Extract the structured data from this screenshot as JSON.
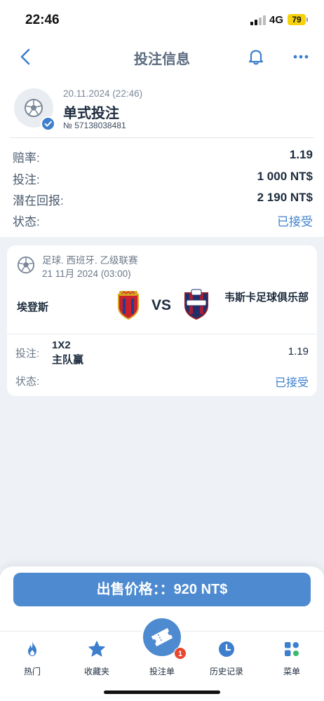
{
  "status_bar": {
    "time": "22:46",
    "network": "4G",
    "battery": "79"
  },
  "nav": {
    "title": "投注信息",
    "back_icon": "chevron-left-icon",
    "bell_icon": "bell-icon",
    "more_icon": "more-icon"
  },
  "bet": {
    "date": "20.11.2024 (22:46)",
    "type": "单式投注",
    "id": "№ 57138038481",
    "rows": [
      {
        "label": "赔率:",
        "value": "1.19"
      },
      {
        "label": "投注:",
        "value": "1 000 NT$"
      },
      {
        "label": "潜在回报:",
        "value": "2 190 NT$"
      },
      {
        "label": "状态:",
        "value": "已接受"
      }
    ]
  },
  "event": {
    "league": "足球. 西班牙. 乙级联赛",
    "datetime": "21 11月 2024 (03:00)",
    "home_team": "埃登斯",
    "vs": "VS",
    "away_team": "韦斯卡足球俱乐部",
    "pick_label": "投注:",
    "pick_market": "1X2",
    "pick_selection": "主队赢",
    "pick_odds": "1.19",
    "status_label": "状态:",
    "status_value": "已接受"
  },
  "sell": {
    "label": "出售价格：：920 NT$"
  },
  "tabbar": {
    "items": [
      {
        "label": "热门",
        "icon": "flame-icon"
      },
      {
        "label": "收藏夹",
        "icon": "star-icon"
      },
      {
        "label": "投注单",
        "icon": "ticket-icon",
        "badge": "1"
      },
      {
        "label": "历史记录",
        "icon": "clock-icon"
      },
      {
        "label": "菜单",
        "icon": "menu-grid-icon"
      }
    ]
  },
  "colors": {
    "accent": "#4d8ad0",
    "status_accepted": "#3d7fcc",
    "badge": "#e8472e"
  }
}
